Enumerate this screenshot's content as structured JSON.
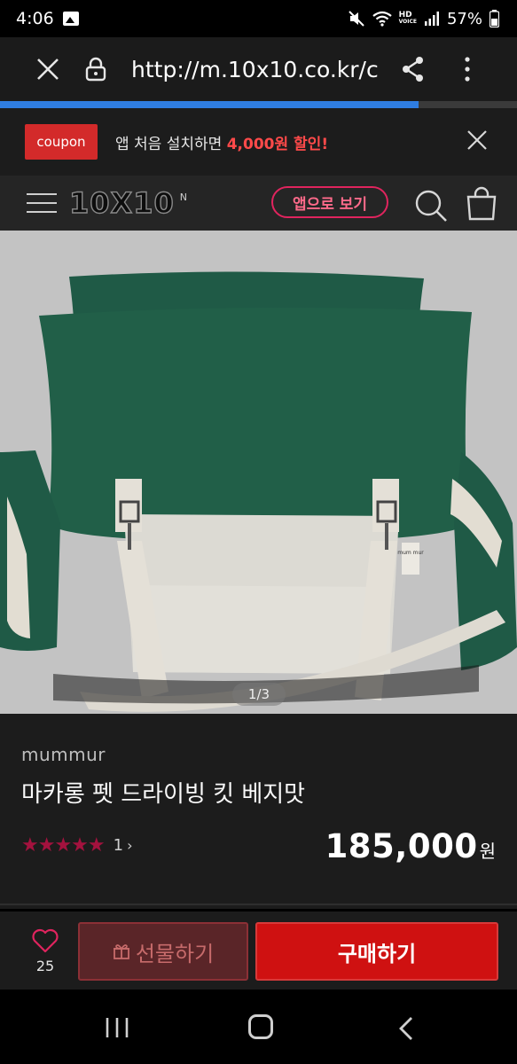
{
  "status_bar": {
    "time": "4:06",
    "battery": "57%",
    "hd_label": "HD",
    "voice_label": "VOICE",
    "icons": [
      "image-icon",
      "mute-icon",
      "wifi-icon",
      "signal-icon",
      "battery-icon"
    ]
  },
  "browser": {
    "url": "http://m.10x10.co.kr/c",
    "progress_fraction": 0.81,
    "colors": {
      "progress": "#2f7de1"
    }
  },
  "coupon_banner": {
    "tag": "coupon",
    "text_before": "앱 처음 설치하면 ",
    "highlight": "4,000원 할인!"
  },
  "site_header": {
    "logo": "10X10",
    "logo_superscript": "N",
    "app_button": "앱으로 보기"
  },
  "product": {
    "image_counter": "1/3",
    "brand": "mummur",
    "title": "마카롱 펫 드라이빙 킷 베지맛",
    "rating_stars": 5,
    "review_count": "1",
    "review_chevron": "›",
    "price": "185,000",
    "price_unit": "원",
    "tag_text": "mum mur"
  },
  "actions": {
    "like_count": "25",
    "gift_label": "선물하기",
    "buy_label": "구매하기",
    "colors": {
      "buy": "#cf1111",
      "gift": "#5a2528"
    }
  }
}
